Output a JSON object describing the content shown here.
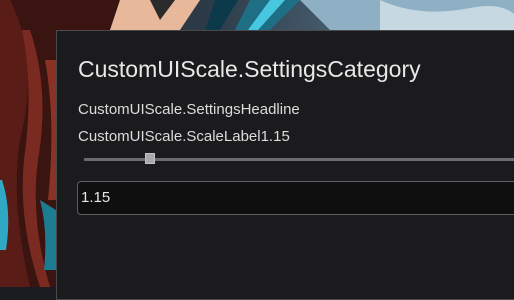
{
  "settings": {
    "category_title": "CustomUIScale.SettingsCategory",
    "headline": "CustomUIScale.SettingsHeadline",
    "scale_label": "CustomUIScale.ScaleLabel1.15",
    "slider_fraction": 0.15,
    "input_value": "1.15"
  },
  "colors": {
    "panel_bg": "#1b1b1d",
    "panel_border": "#4a4a4e",
    "text": "#e8e8e8",
    "input_bg": "#0f0f10"
  }
}
